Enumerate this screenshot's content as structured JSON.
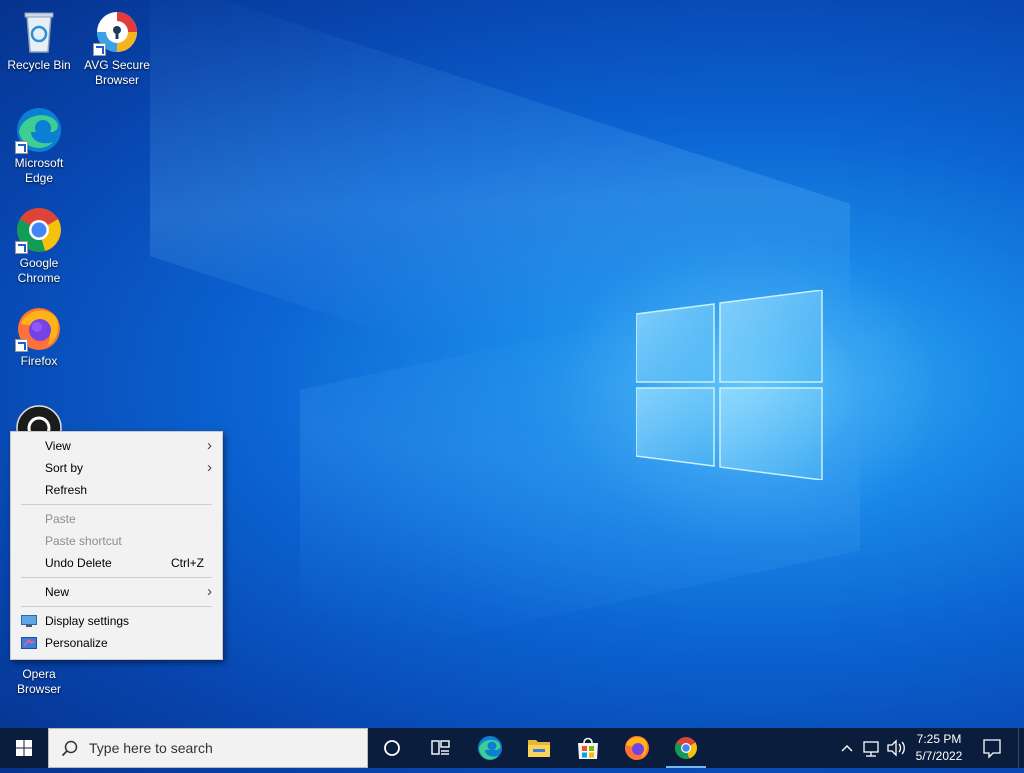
{
  "desktop": {
    "icons": [
      {
        "label": "Recycle Bin",
        "icon": "recycle-bin-icon"
      },
      {
        "label": "AVG Secure Browser",
        "icon": "avg-browser-icon"
      },
      {
        "label": "Microsoft Edge",
        "icon": "edge-icon"
      },
      {
        "label": "Google Chrome",
        "icon": "chrome-icon"
      },
      {
        "label": "Firefox",
        "icon": "firefox-icon"
      },
      {
        "label": "Opera Browser",
        "icon": "opera-icon"
      }
    ]
  },
  "context_menu": {
    "items": [
      {
        "label": "View",
        "submenu": true
      },
      {
        "label": "Sort by",
        "submenu": true
      },
      {
        "label": "Refresh"
      },
      {
        "label": "Paste",
        "disabled": true
      },
      {
        "label": "Paste shortcut",
        "disabled": true
      },
      {
        "label": "Undo Delete",
        "accel": "Ctrl+Z"
      },
      {
        "label": "New",
        "submenu": true
      },
      {
        "label": "Display settings",
        "icon": "display-settings-icon"
      },
      {
        "label": "Personalize",
        "icon": "personalize-icon"
      }
    ]
  },
  "taskbar": {
    "search_placeholder": "Type here to search",
    "pinned": [
      "cortana-icon",
      "task-view-icon",
      "edge-icon",
      "file-explorer-icon",
      "store-icon",
      "firefox-icon",
      "chrome-icon"
    ],
    "clock": {
      "time": "7:25 PM",
      "date": "5/7/2022"
    }
  },
  "colors": {
    "taskbar": "#0a1d3d",
    "desktop_accent": "#0b63d2",
    "menu_bg": "#f2f2f2"
  }
}
